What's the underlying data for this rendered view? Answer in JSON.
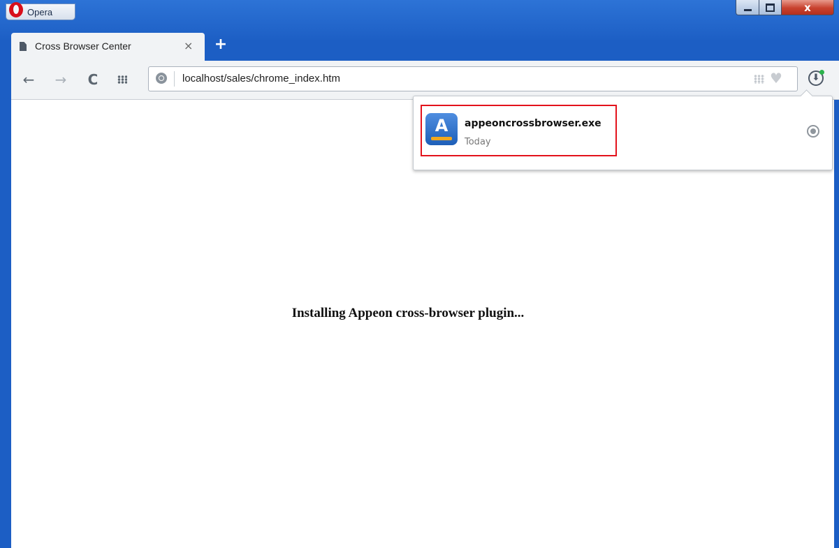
{
  "window": {
    "app_label": "Opera",
    "min_icon": "minimize-icon",
    "max_icon": "maximize-icon",
    "close_glyph": "x"
  },
  "tabs": [
    {
      "title": "Cross Browser Center",
      "close_glyph": "×",
      "icon": "page-icon"
    }
  ],
  "new_tab_glyph": "+",
  "toolbar": {
    "back_glyph": "←",
    "forward_glyph": "→",
    "reload_glyph": "C",
    "url": "localhost/sales/chrome_index.htm",
    "heart_glyph": "♥",
    "download_glyph": "⬇"
  },
  "content": {
    "message": "Installing Appeon cross-browser plugin..."
  },
  "downloads": {
    "items": [
      {
        "file_name": "appeoncrossbrowser.exe",
        "date": "Today",
        "icon_letter": "A"
      }
    ]
  },
  "colors": {
    "frame": "#1c5ec4",
    "highlight_border": "#e3121b",
    "download_indicator": "#2bb24c"
  }
}
